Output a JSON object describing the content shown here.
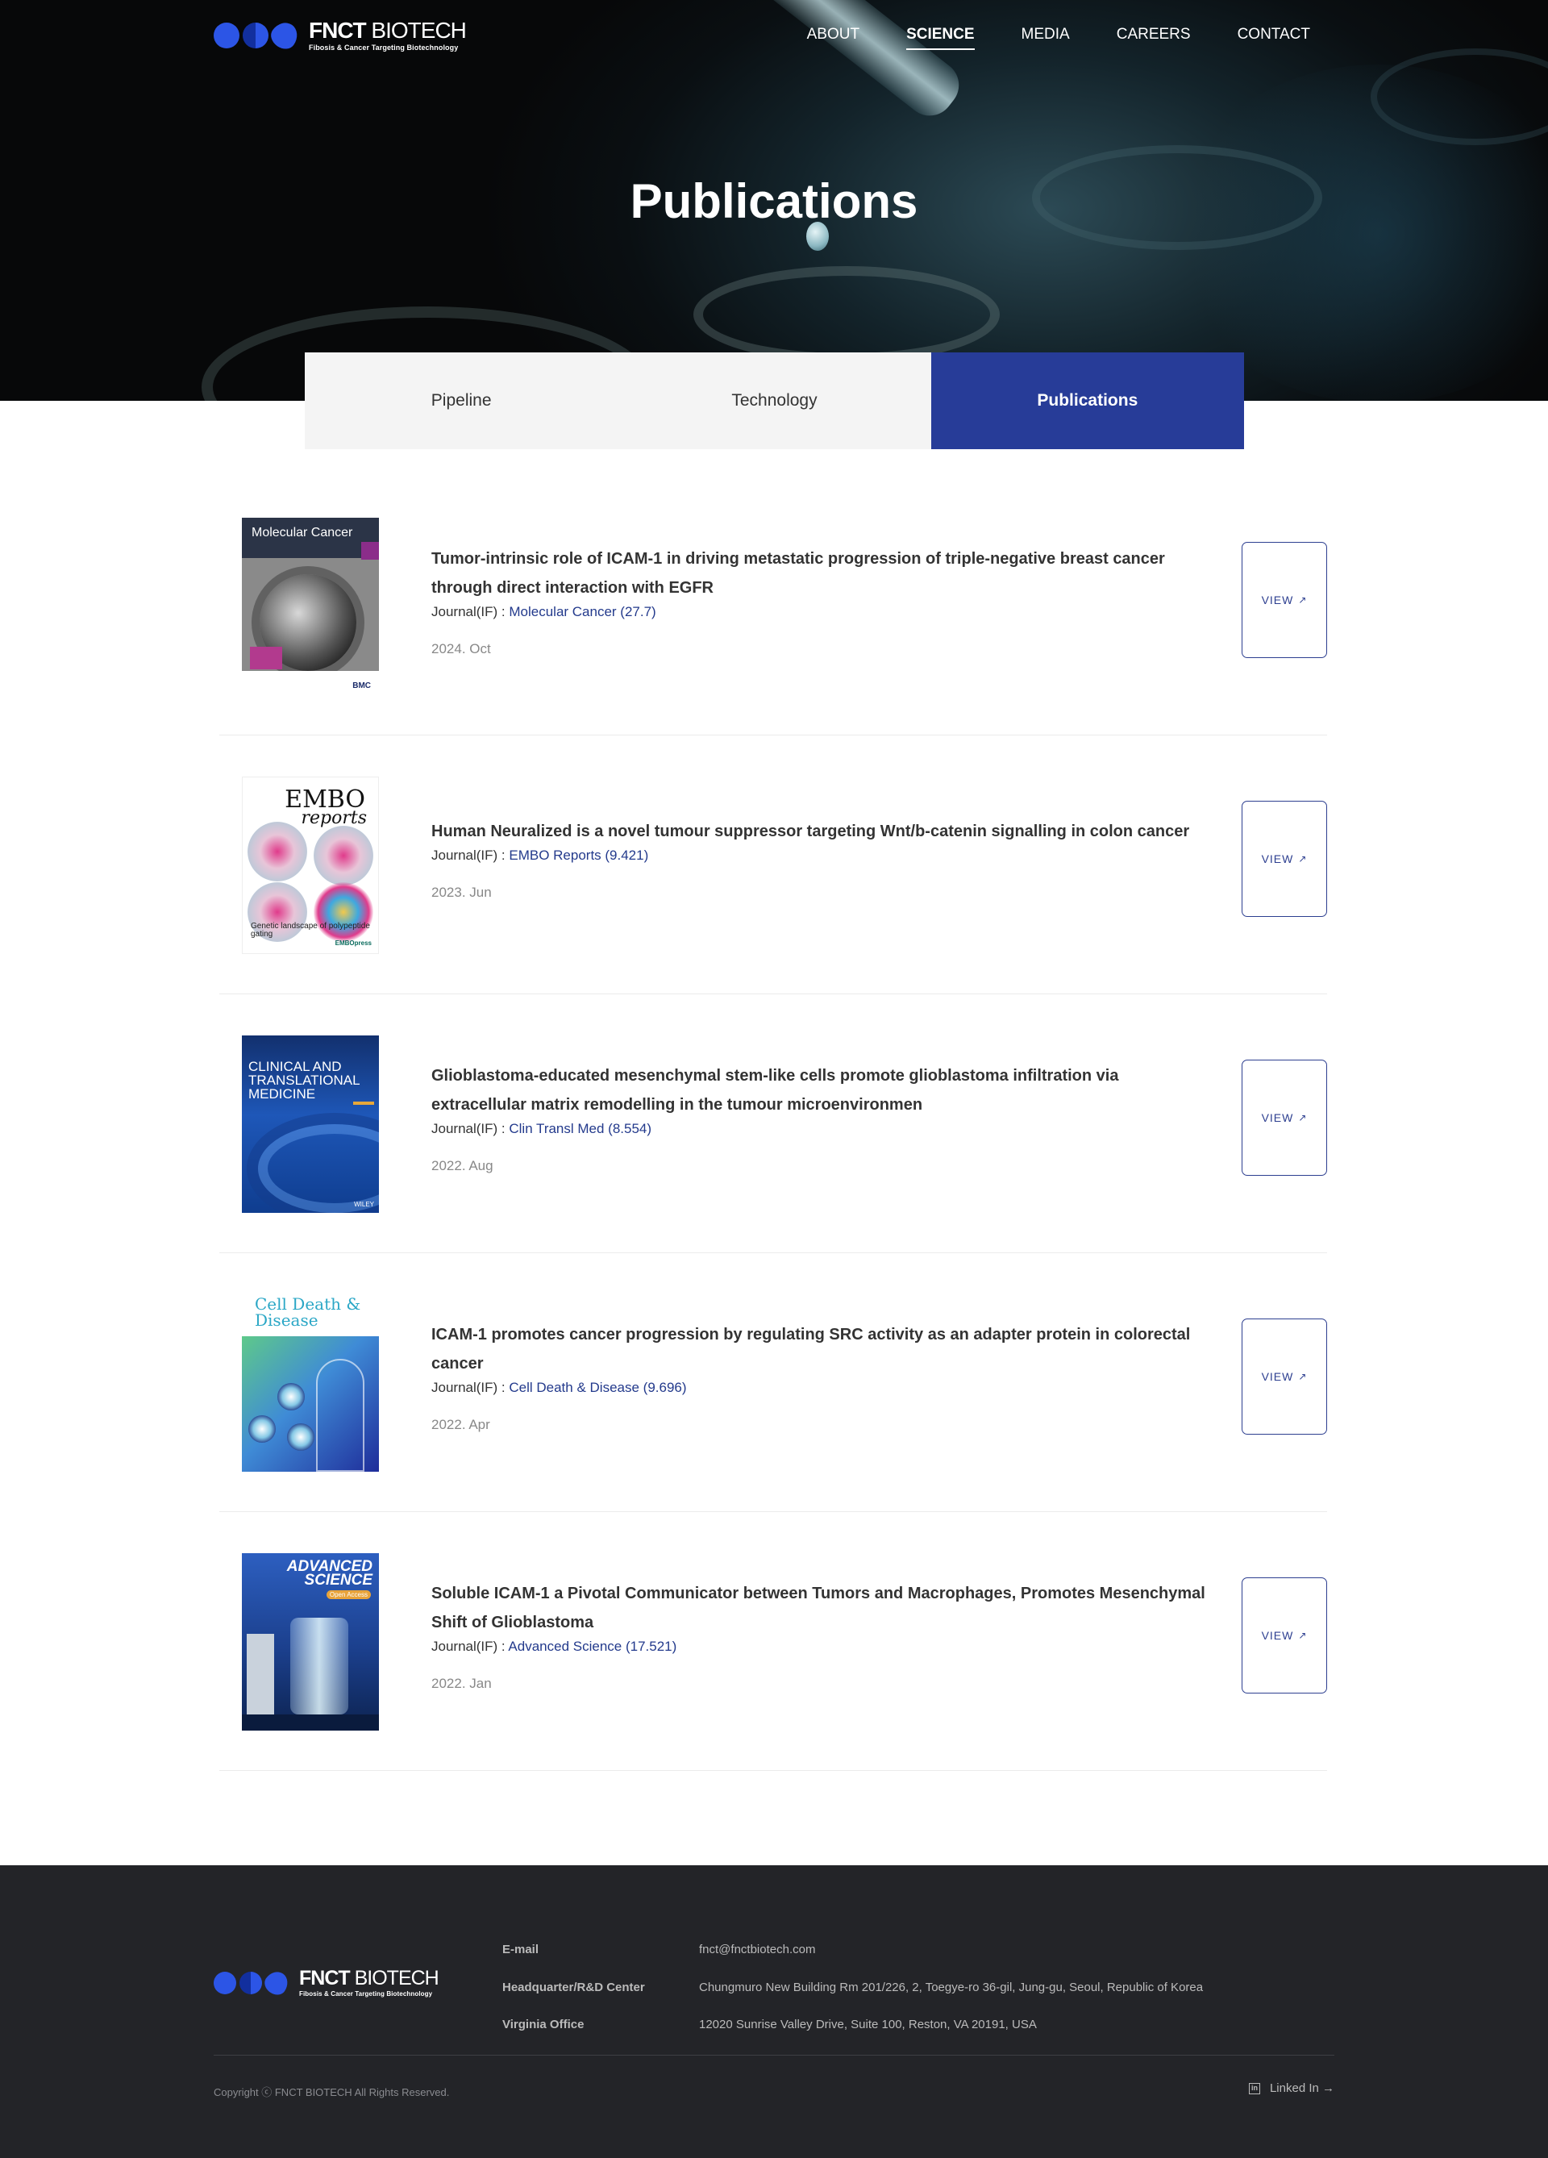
{
  "header": {
    "logo": {
      "name_bold": "FNCT",
      "name_rest": " BIOTECH",
      "tagline": "Fibosis & Cancer Targeting Biotechnology"
    },
    "nav": [
      {
        "label": "ABOUT",
        "active": false
      },
      {
        "label": "SCIENCE",
        "active": true
      },
      {
        "label": "MEDIA",
        "active": false
      },
      {
        "label": "CAREERS",
        "active": false
      },
      {
        "label": "CONTACT",
        "active": false
      }
    ]
  },
  "hero": {
    "title": "Publications"
  },
  "tabs": [
    {
      "label": "Pipeline",
      "active": false
    },
    {
      "label": "Technology",
      "active": false
    },
    {
      "label": "Publications",
      "active": true
    }
  ],
  "publications": [
    {
      "title": "Tumor-intrinsic role of ICAM-1 in driving metastatic progression of triple-negative breast cancer through direct interaction with EGFR",
      "journal_label": "Journal(IF) : ",
      "journal": "Molecular Cancer (27.7)",
      "date": "2024. Oct",
      "cover_text": "Molecular Cancer",
      "cover_sub": "BMC"
    },
    {
      "title": "Human Neuralized is a novel tumour suppressor targeting Wnt/b-catenin signalling in colon cancer",
      "journal_label": "Journal(IF) : ",
      "journal": "EMBO Reports (9.421)",
      "date": "2023. Jun",
      "cover_text": "EMBO",
      "cover_sub": "reports",
      "cover_caption": "Genetic landscape of polypeptide gating",
      "cover_pub": "EMBOpress"
    },
    {
      "title": "Glioblastoma-educated mesenchymal stem-like cells promote glioblastoma infiltration via extracellular matrix remodelling in the tumour microenvironmen",
      "journal_label": "Journal(IF) : ",
      "journal": "Clin Transl Med (8.554)",
      "date": "2022. Aug",
      "cover_text": "CLINICAL AND TRANSLATIONAL MEDICINE",
      "cover_sub": "WILEY"
    },
    {
      "title": "ICAM-1 promotes cancer progression by regulating SRC activity as an adapter protein in colorectal cancer",
      "journal_label": "Journal(IF) : ",
      "journal": "Cell Death & Disease (9.696)",
      "date": "2022. Apr",
      "cover_text": "Cell Death & Disease"
    },
    {
      "title": "Soluble ICAM-1 a Pivotal Communicator between Tumors and Macrophages, Promotes Mesenchymal Shift of Glioblastoma",
      "journal_label": "Journal(IF) : ",
      "journal": "Advanced Science (17.521)",
      "date": "2022. Jan",
      "cover_text": "ADVANCED SCIENCE",
      "cover_sub": "Open Access"
    }
  ],
  "view_label": "VIEW",
  "view_icon": "↗",
  "footer": {
    "rows": [
      {
        "key": "E-mail",
        "value": "fnct@fnctbiotech.com"
      },
      {
        "key": "Headquarter/R&D Center",
        "value": "Chungmuro New Building Rm 201/226, 2, Toegye-ro 36-gil, Jung-gu, Seoul, Republic of Korea"
      },
      {
        "key": "Virginia Office",
        "value": "12020 Sunrise Valley Drive, Suite 100, Reston, VA 20191, USA"
      }
    ],
    "copyright": "Copyright ⓒ FNCT BIOTECH All Rights Reserved.",
    "linkedin": "Linked In →",
    "linkedin_icon": "in"
  },
  "colors": {
    "accent": "#273c98",
    "footer_bg": "#232428",
    "logo_blue": "#2c55e6"
  }
}
